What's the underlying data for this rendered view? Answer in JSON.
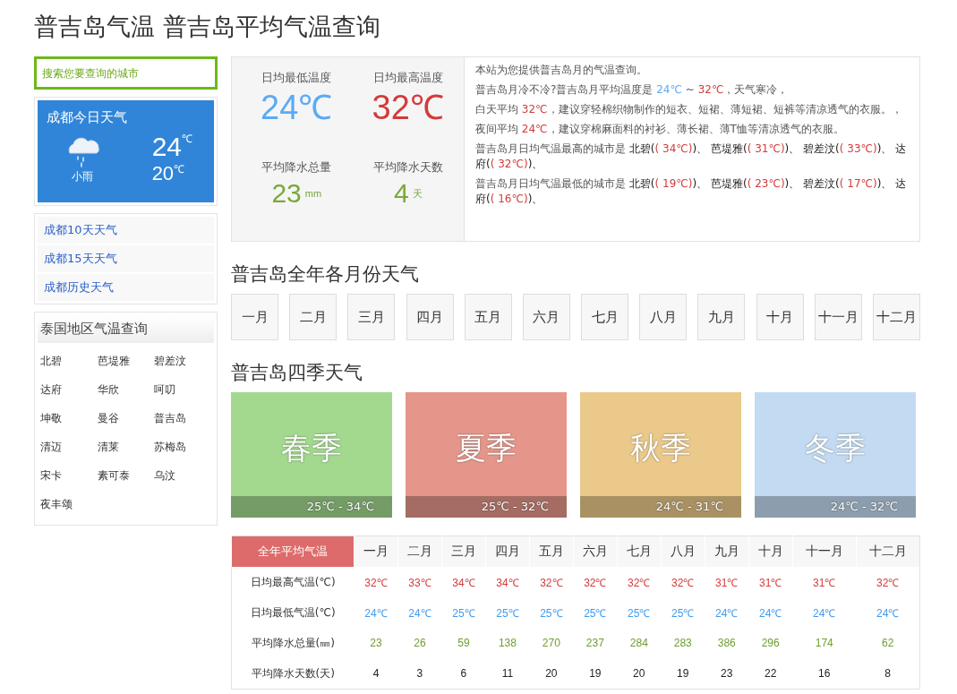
{
  "page_title": "普吉岛气温 普吉岛平均气温查询",
  "search": {
    "placeholder": "搜索您要查询的城市"
  },
  "today": {
    "title": "成都今日天气",
    "condition": "小雨",
    "high": "24",
    "low": "20",
    "unit": "℃"
  },
  "links": [
    "成都10天天气",
    "成都15天天气",
    "成都历史天气"
  ],
  "region": {
    "title": "泰国地区气温查询",
    "cities": [
      "北碧",
      "芭堤雅",
      "碧差汶",
      "达府",
      "华欣",
      "呵叨",
      "坤敬",
      "曼谷",
      "普吉岛",
      "清迈",
      "清莱",
      "苏梅岛",
      "宋卡",
      "素可泰",
      "乌汶",
      "夜丰颂"
    ]
  },
  "stats": [
    {
      "label": "日均最低温度",
      "value": "24℃",
      "color": "#5aabf5"
    },
    {
      "label": "日均最高温度",
      "value": "32℃",
      "color": "#d43a3a"
    },
    {
      "label": "平均降水总量",
      "value": "23",
      "unit": "mm",
      "color": "#7aa83a"
    },
    {
      "label": "平均降水天数",
      "value": "4",
      "unit": "天",
      "color": "#7aa83a"
    }
  ],
  "description": [
    [
      {
        "kind": "text",
        "text": "本站为您提供普吉岛月的气温查询。"
      }
    ],
    [
      {
        "kind": "text",
        "text": "普吉岛月冷不冷?普吉岛月平均温度是 "
      },
      {
        "kind": "value",
        "text": "24℃",
        "color": "#5aabf5"
      },
      {
        "kind": "text",
        "text": " ~ "
      },
      {
        "kind": "value",
        "text": "32℃",
        "color": "#d43a3a"
      },
      {
        "kind": "text",
        "text": "，天气寒冷，"
      }
    ],
    [
      {
        "kind": "text",
        "text": "白天平均 "
      },
      {
        "kind": "value",
        "text": "32℃",
        "color": "#d43a3a"
      },
      {
        "kind": "text",
        "text": "，建议穿轻棉织物制作的短衣、短裙、薄短裙、短裤等清凉透气的衣服。，"
      }
    ],
    [
      {
        "kind": "text",
        "text": "夜间平均 "
      },
      {
        "kind": "value",
        "text": "24℃",
        "color": "#d43a3a"
      },
      {
        "kind": "text",
        "text": "，建议穿棉麻面料的衬衫、薄长裙、薄T恤等清凉透气的衣服。"
      }
    ],
    [
      {
        "kind": "text",
        "text": "普吉岛月日均气温最高的城市是 "
      },
      {
        "kind": "city",
        "text": "北碧("
      },
      {
        "kind": "value",
        "text": "( 34℃)",
        "color": "#d43a3a"
      },
      {
        "kind": "city",
        "text": ")、 芭堤雅("
      },
      {
        "kind": "value",
        "text": "( 31℃)",
        "color": "#d43a3a"
      },
      {
        "kind": "city",
        "text": ")、 碧差汶("
      },
      {
        "kind": "value",
        "text": "( 33℃)",
        "color": "#d43a3a"
      },
      {
        "kind": "city",
        "text": ")、 达府("
      },
      {
        "kind": "value",
        "text": "( 32℃)",
        "color": "#d43a3a"
      },
      {
        "kind": "city",
        "text": ")、"
      }
    ],
    [
      {
        "kind": "text",
        "text": "普吉岛月日均气温最低的城市是 "
      },
      {
        "kind": "city",
        "text": "北碧("
      },
      {
        "kind": "value",
        "text": "( 19℃)",
        "color": "#d43a3a"
      },
      {
        "kind": "city",
        "text": ")、 芭堤雅("
      },
      {
        "kind": "value",
        "text": "( 23℃)",
        "color": "#d43a3a"
      },
      {
        "kind": "city",
        "text": ")、 碧差汶("
      },
      {
        "kind": "value",
        "text": "( 17℃)",
        "color": "#d43a3a"
      },
      {
        "kind": "city",
        "text": ")、 达府("
      },
      {
        "kind": "value",
        "text": "( 16℃)",
        "color": "#d43a3a"
      },
      {
        "kind": "city",
        "text": ")、"
      }
    ]
  ],
  "months_title": "普吉岛全年各月份天气",
  "months": [
    "一月",
    "二月",
    "三月",
    "四月",
    "五月",
    "六月",
    "七月",
    "八月",
    "九月",
    "十月",
    "十一月",
    "十二月"
  ],
  "seasons_title": "普吉岛四季天气",
  "seasons": [
    {
      "name": "春季",
      "range": "25℃ - 34℃",
      "color": "#a3d98f"
    },
    {
      "name": "夏季",
      "range": "25℃ - 32℃",
      "color": "#e5968a"
    },
    {
      "name": "秋季",
      "range": "24℃ - 31℃",
      "color": "#ebc98a"
    },
    {
      "name": "冬季",
      "range": "24℃ - 32℃",
      "color": "#c3dbf2"
    }
  ],
  "table": {
    "header": "全年平均气温",
    "columns": [
      "一月",
      "二月",
      "三月",
      "四月",
      "五月",
      "六月",
      "七月",
      "八月",
      "九月",
      "十月",
      "十一月",
      "十二月"
    ],
    "rows": [
      {
        "label": "日均最高气温(℃)",
        "color": "#d43a3a",
        "values": [
          "32℃",
          "33℃",
          "34℃",
          "34℃",
          "32℃",
          "32℃",
          "32℃",
          "32℃",
          "31℃",
          "31℃",
          "31℃",
          "32℃"
        ]
      },
      {
        "label": "日均最低气温(℃)",
        "color": "#3d9bf0",
        "values": [
          "24℃",
          "24℃",
          "25℃",
          "25℃",
          "25℃",
          "25℃",
          "25℃",
          "25℃",
          "24℃",
          "24℃",
          "24℃",
          "24℃"
        ]
      },
      {
        "label": "平均降水总量(㎜)",
        "color": "#6f9e2e",
        "values": [
          "23",
          "26",
          "59",
          "138",
          "270",
          "237",
          "284",
          "283",
          "386",
          "296",
          "174",
          "62"
        ]
      },
      {
        "label": "平均降水天数(天)",
        "color": "#222222",
        "values": [
          "4",
          "3",
          "6",
          "11",
          "20",
          "19",
          "20",
          "19",
          "23",
          "22",
          "16",
          "8"
        ]
      }
    ]
  }
}
